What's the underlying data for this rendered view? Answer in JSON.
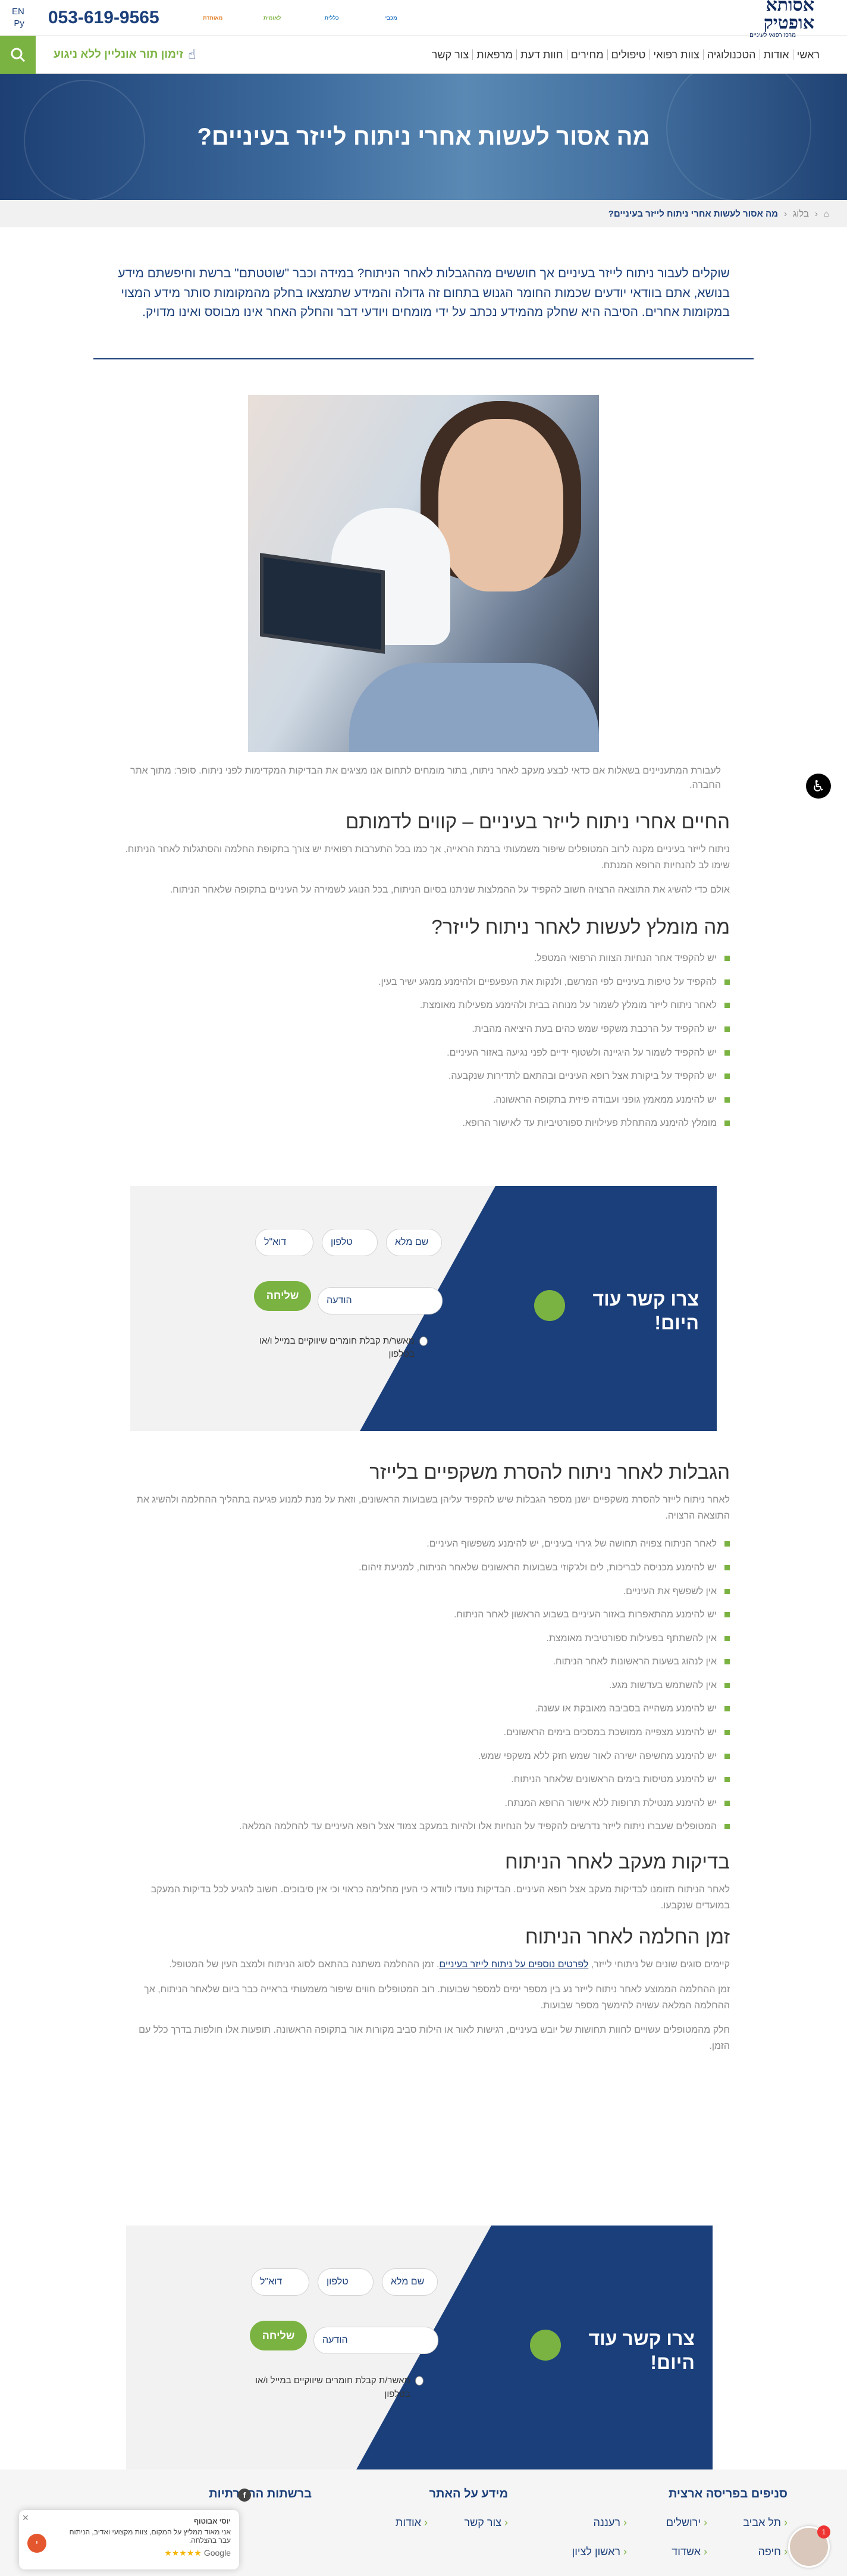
{
  "header": {
    "logo_main": "אסותא אופטיק",
    "logo_sub": "מרכז רפואי לעיניים",
    "phone": "053-619-9565",
    "langs": [
      "EN",
      "Ру"
    ],
    "partners": [
      "מכבי",
      "כללית",
      "לאומית",
      "מאוחדת"
    ]
  },
  "nav": {
    "items": [
      "ראשי",
      "אודות",
      "הטכנולוגיה",
      "צוות רפואי",
      "טיפולים",
      "מחירים",
      "חוות דעת",
      "מרפאות",
      "צור קשר"
    ],
    "cta": "זימון תור אונליין ללא ניגוע"
  },
  "hero": {
    "title": "מה אסור לעשות אחרי ניתוח לייזר בעיניים?"
  },
  "breadcrumb": {
    "home": "ראשי",
    "blog": "בלוג",
    "current": "מה אסור לעשות אחרי ניתוח לייזר בעיניים?"
  },
  "intro": "שוקלים לעבור ניתוח לייזר בעיניים אך חוששים מההגבלות לאחר הניתוח? במידה וכבר \"שוטטתם\" ברשת וחיפשתם מידע בנושא, אתם בוודאי יודעים שכמות החומר הגנוש בתחום זה גדולה והמידע שתמצאו בחלק מהמקומות סותר מידע המצוי במקומות אחרים. הסיבה היא שחלק מהמידע נכתב על ידי מומחים ויודעי דבר והחלק האחר אינו מבוסס ואינו מדויק.",
  "image_caption": "לעבורת המתעניינים בשאלות אם כדאי לבצע מעקב לאחר ניתוח, בתור מומחים לתחום אנו מציגים את הבדיקות המקדימות לפני ניתוח. סופר: מתוך אתר החברה.",
  "section1": {
    "title": "החיים אחרי ניתוח לייזר בעיניים – קווים לדמותם",
    "p1": "ניתוח לייזר בעיניים מקנה לרוב המטופלים שיפור משמעותי ברמת הראייה, אך כמו בכל התערבות רפואית יש צורך בתקופת החלמה והסתגלות לאחר הניתוח. שימו לב להנחיות הרופא המנתח.",
    "p2": "אולם כדי להשיג את התוצאה הרצויה חשוב להקפיד על ההמלצות שניתנו בסיום הניתוח, בכל הנוגע לשמירה על העיניים בתקופה שלאחר הניתוח."
  },
  "section2": {
    "title": "מה מומלץ לעשות לאחר ניתוח לייזר?",
    "items": [
      "יש להקפיד אחר הנחיות הצוות הרפואי המטפל.",
      "להקפיד על טיפות בעיניים לפי המרשם, ולנקות את העפעפיים ולהימנע ממגע ישיר בעין.",
      "לאחר ניתוח לייזר מומלץ לשמור על מנוחה בבית ולהימנע מפעילות מאומצת.",
      "יש להקפיד על הרכבת משקפי שמש כהים בעת היציאה מהבית.",
      "יש להקפיד לשמור על היגיינה ולשטוף ידיים לפני נגיעה באזור העיניים.",
      "יש להקפיד על ביקורת אצל רופא העיניים ובהתאם לתדירות שנקבעה.",
      "יש להימנע ממאמץ גופני ועבודה פיזית בתקופה הראשונה.",
      "מומלץ להימנע מהתחלת פעילויות ספורטיביות עד לאישור הרופא."
    ]
  },
  "contact": {
    "title": "צרו קשר עוד היום!",
    "fields": {
      "name": "שם מלא",
      "phone": "טלפון",
      "email": "דוא\"ל",
      "message": "הודעה"
    },
    "send": "שליחה",
    "consent": "מאשר/ת קבלת חומרים שיווקיים במייל ו/או בטלפון"
  },
  "section3": {
    "title": "הגבלות לאחר ניתוח להסרת משקפיים בלייזר",
    "p1": "לאחר ניתוח לייזר להסרת משקפיים ישנן מספר הגבלות שיש להקפיד עליהן בשבועות הראשונים, וזאת על מנת למנוע פגיעה בתהליך ההחלמה ולהשיג את התוצאה הרצויה.",
    "items": [
      "לאחר הניתוח צפויה תחושה של גירוי בעיניים, יש להימנע משפשוף העיניים.",
      "יש להימנע מכניסה לבריכות, לים ולג'קוזי בשבועות הראשונים שלאחר הניתוח, למניעת זיהום.",
      "אין לשפשף את העיניים.",
      "יש להימנע מהתאפרות באזור העיניים בשבוע הראשון לאחר הניתוח.",
      "אין להשתתף בפעילות ספורטיבית מאומצת.",
      "אין לנהוג בשעות הראשונות לאחר הניתוח.",
      "אין להשתמש בעדשות מגע.",
      "יש להימנע משהייה בסביבה מאובקת או עשנה.",
      "יש להימנע מצפייה ממושכת במסכים בימים הראשונים.",
      "יש להימנע מחשיפה ישירה לאור שמש חזק ללא משקפי שמש.",
      "יש להימנע מטיסות בימים הראשונים שלאחר הניתוח.",
      "יש להימנע מנטילת תרופות ללא אישור הרופא המנתח.",
      "המטופלים שעברו ניתוח לייזר נדרשים להקפיד על הנחיות אלו ולהיות במעקב צמוד אצל רופא העיניים עד להחלמה המלאה."
    ]
  },
  "section4": {
    "title": "בדיקות מעקב לאחר הניתוח",
    "p1": "לאחר הניתוח תזומנו לבדיקות מעקב אצל רופא העיניים. הבדיקות נועדו לוודא כי העין מחלימה כראוי וכי אין סיבוכים. חשוב להגיע לכל בדיקות המעקב במועדים שנקבעו."
  },
  "section5": {
    "title": "זמן החלמה לאחר הניתוח",
    "p1_prefix": "קיימים סוגים שונים של ניתוחי לייזר, ",
    "p1_link": "לפרטים נוספים על ניתוח לייזר בעיניים",
    "p1_suffix": ". זמן ההחלמה משתנה בהתאם לסוג הניתוח ולמצב העין של המטופל.",
    "p2": "זמן ההחלמה הממוצע לאחר ניתוח לייזר נע בין מספר ימים למספר שבועות. רוב המטופלים חווים שיפור משמעותי בראייה כבר ביום שלאחר הניתוח, אך ההחלמה המלאה עשויה להימשך מספר שבועות.",
    "p3": "חלק מהמטופלים עשויים לחוות תחושות של יובש בעיניים, רגישות לאור או הילות סביב מקורות אור בתקופה הראשונה. תופעות אלו חולפות בדרך כלל עם הזמן."
  },
  "footer": {
    "branches_title": "סניפים בפריסה ארצית",
    "branches": [
      "תל אביב",
      "ירושלים",
      "רעננה",
      "חיפה",
      "אשדוד",
      "ראשון לציון"
    ],
    "info_title": "מידע על האתר",
    "info": [
      "צור קשר",
      "אודות"
    ],
    "social_title": "ברשתות החברתיות"
  },
  "review": {
    "name": "יוסי אבוטוף",
    "text": "אני מאוד ממליץ על המקום, צוות מקצועי ואדיב, הניתוח עבר בהצלחה.",
    "source": "Google",
    "stars": "★★★★★"
  },
  "chat_badge": "1"
}
